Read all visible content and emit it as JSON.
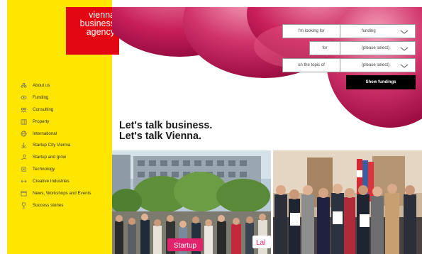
{
  "logo": {
    "lines": [
      "vienna",
      "business",
      "agency"
    ]
  },
  "nav": {
    "items": [
      {
        "label": "About us",
        "icon": "about-icon"
      },
      {
        "label": "Funding",
        "icon": "funding-icon"
      },
      {
        "label": "Consulting",
        "icon": "consulting-icon"
      },
      {
        "label": "Property",
        "icon": "property-icon"
      },
      {
        "label": "International",
        "icon": "globe-icon"
      },
      {
        "label": "Startup City Vienna",
        "icon": "startup-icon"
      },
      {
        "label": "Startup and grow",
        "icon": "grow-icon"
      },
      {
        "label": "Technology",
        "icon": "technology-icon"
      },
      {
        "label": "Creative Industries",
        "icon": "creative-icon"
      },
      {
        "label": "News, Workshops and Events",
        "icon": "calendar-icon"
      },
      {
        "label": "Success stories",
        "icon": "trophy-icon"
      }
    ]
  },
  "search": {
    "rows": [
      {
        "label": "I'm looking for",
        "value": "funding"
      },
      {
        "label": "for",
        "value": "(please select)"
      },
      {
        "label": "on the topic of",
        "value": "(please select)"
      }
    ],
    "submit_label": "Show fundings"
  },
  "headline": {
    "line1": "Let's talk business.",
    "line2": "Let's talk Vienna."
  },
  "photos": {
    "sign_left": "Startup",
    "sign_right": "Lal"
  },
  "colors": {
    "sidebar": "#ffe600",
    "logo": "#e30613",
    "bubble": "#c2185b",
    "button": "#000000"
  }
}
